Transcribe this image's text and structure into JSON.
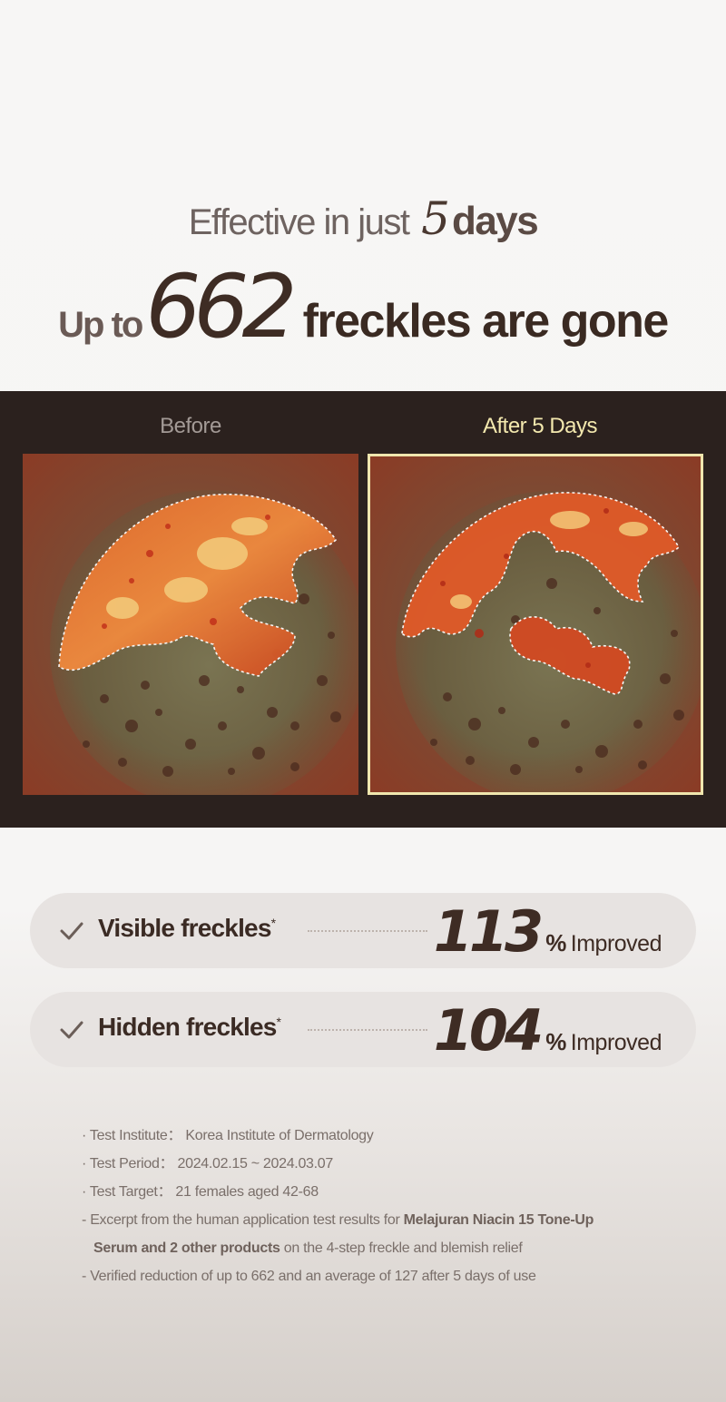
{
  "headline": {
    "line1_prefix": "Effective in just",
    "line1_number": "5",
    "line1_suffix": "days",
    "line2_prefix": "Up to",
    "line2_number": "662",
    "line2_suffix": "freckles are gone"
  },
  "comparison": {
    "before_label": "Before",
    "after_label": "After 5 Days"
  },
  "stats": [
    {
      "label": "Visible freckles",
      "mark": "*",
      "value": "113",
      "unit": "%",
      "suffix": "Improved"
    },
    {
      "label": "Hidden freckles",
      "mark": "*",
      "value": "104",
      "unit": "%",
      "suffix": "Improved"
    }
  ],
  "notes": {
    "institute_label": "Test Institute",
    "institute_value": "Korea Institute of Dermatology",
    "period_label": "Test Period",
    "period_value": "2024.02.15 ~ 2024.03.07",
    "target_label": "Test Target",
    "target_value": "21 females aged 42-68",
    "excerpt_prefix": "Excerpt from the human application test results for",
    "excerpt_bold_1": "Melajuran Niacin 15 Tone-Up",
    "excerpt_bold_2": "Serum and 2 other products",
    "excerpt_suffix": "on the 4-step freckle and blemish relief",
    "verified": "Verified reduction of up to 662 and an average of 127 after 5 days of use"
  },
  "colors": {
    "dark_band": "#2b211e",
    "after_accent": "#f0e6ae",
    "heading_brown": "#3e2c24",
    "pill_bg": "#e7e3e1"
  }
}
